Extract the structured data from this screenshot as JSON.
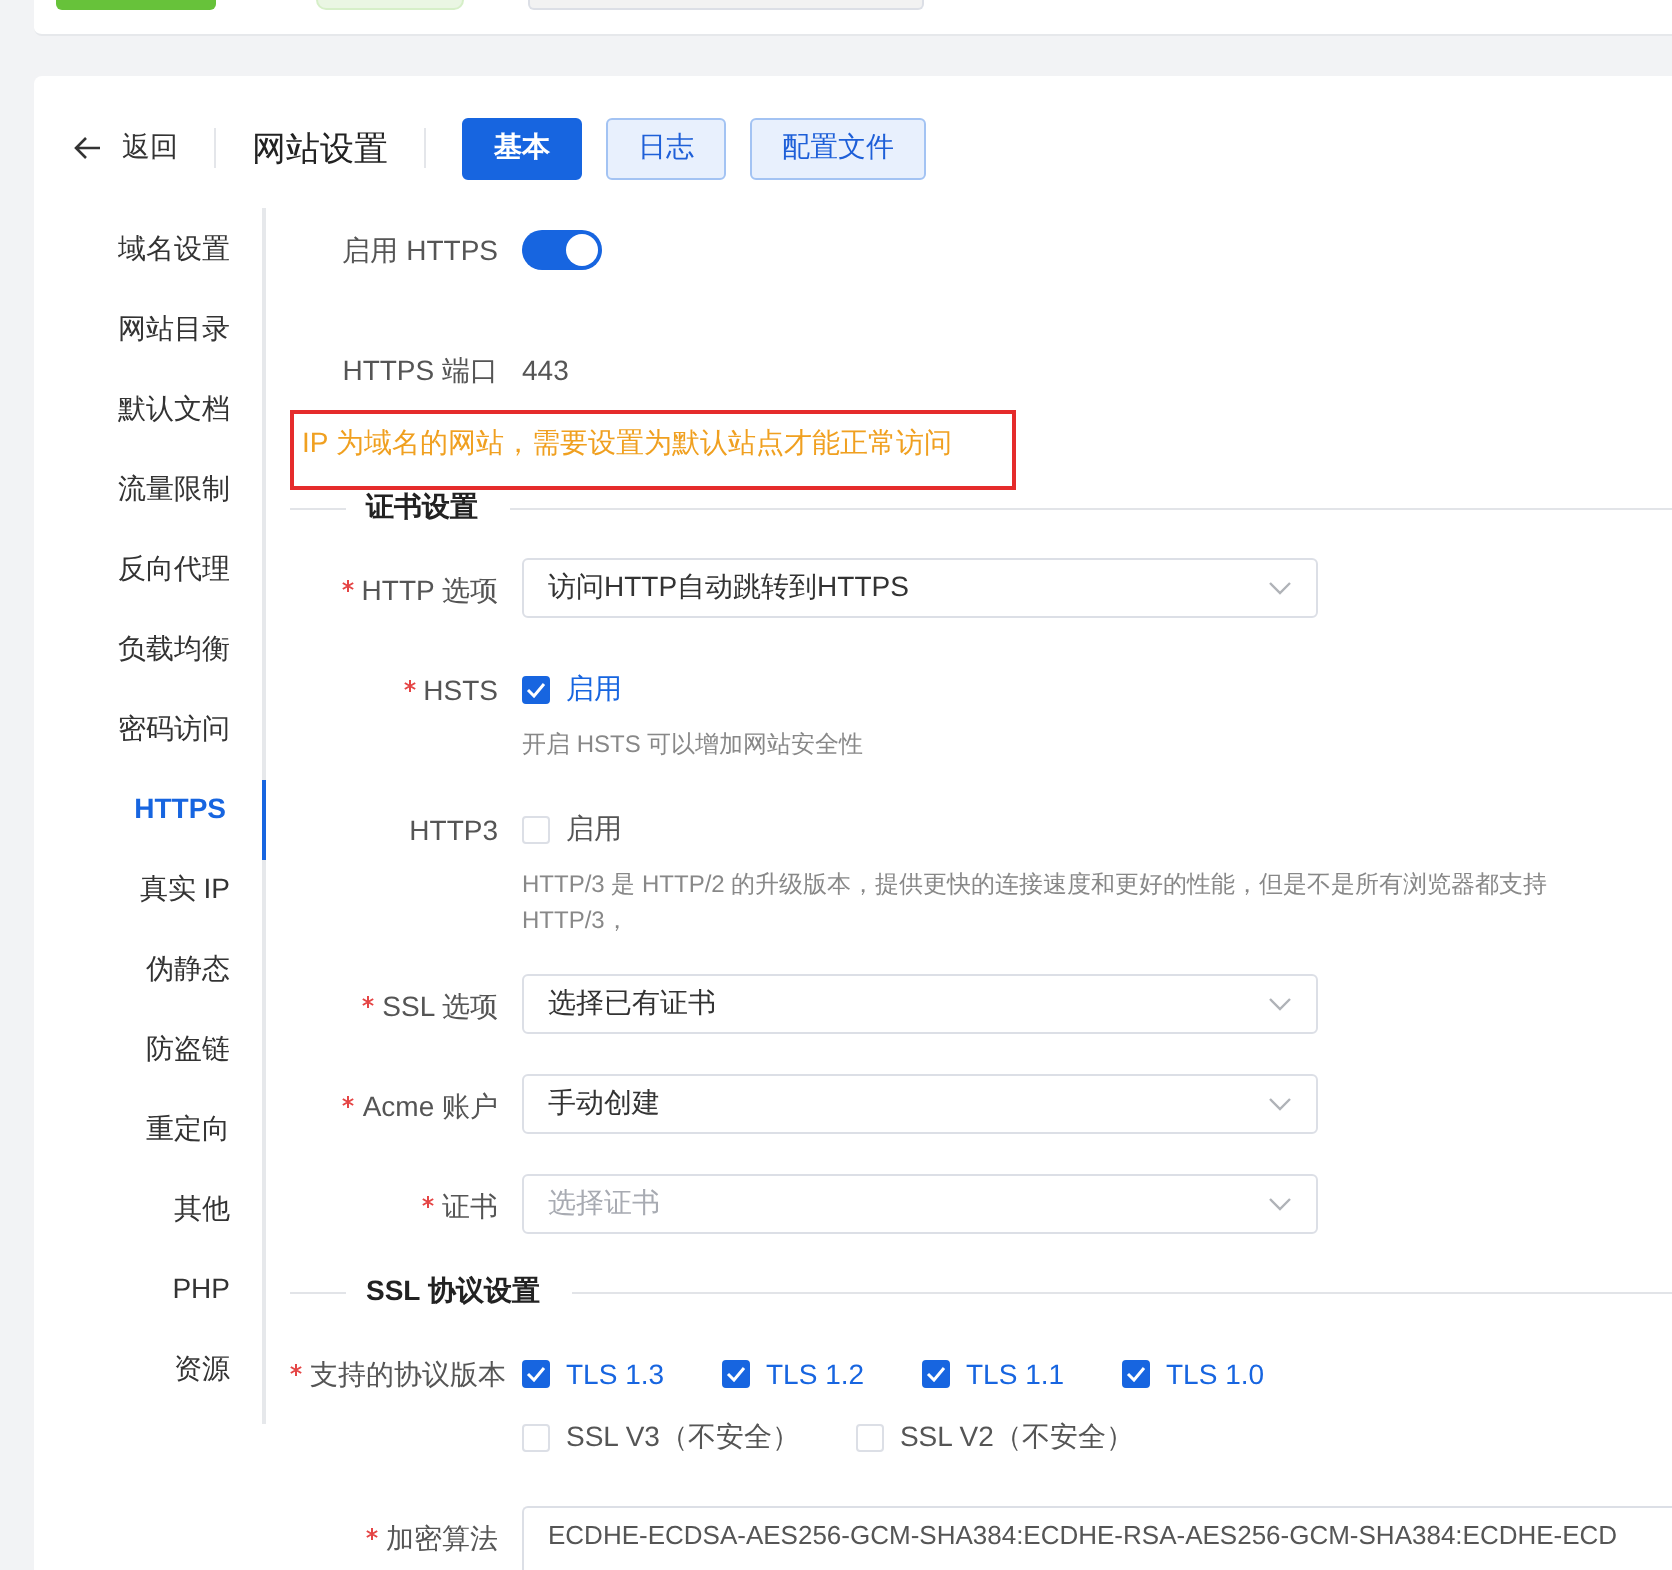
{
  "header": {
    "back": "返回",
    "title": "网站设置",
    "tabs": [
      {
        "label": "基本",
        "selected": true
      },
      {
        "label": "日志",
        "selected": false
      },
      {
        "label": "配置文件",
        "selected": false
      }
    ]
  },
  "sidebar": {
    "items": [
      {
        "label": "域名设置",
        "selected": false
      },
      {
        "label": "网站目录",
        "selected": false
      },
      {
        "label": "默认文档",
        "selected": false
      },
      {
        "label": "流量限制",
        "selected": false
      },
      {
        "label": "反向代理",
        "selected": false
      },
      {
        "label": "负载均衡",
        "selected": false
      },
      {
        "label": "密码访问",
        "selected": false
      },
      {
        "label": "HTTPS",
        "selected": true
      },
      {
        "label": "真实 IP",
        "selected": false
      },
      {
        "label": "伪静态",
        "selected": false
      },
      {
        "label": "防盗链",
        "selected": false
      },
      {
        "label": "重定向",
        "selected": false
      },
      {
        "label": "其他",
        "selected": false
      },
      {
        "label": "PHP",
        "selected": false
      },
      {
        "label": "资源",
        "selected": false
      }
    ]
  },
  "form": [
    {
      "kind": "switch",
      "label": "启用 HTTPS",
      "on": true
    },
    {
      "kind": "text",
      "label": "HTTPS 端口",
      "value": "443"
    },
    {
      "kind": "warning",
      "text": "IP 为域名的网站，需要设置为默认站点才能正常访问"
    },
    {
      "kind": "section",
      "title": "证书设置"
    },
    {
      "kind": "select",
      "label": "HTTP 选项",
      "required": true,
      "value": "访问HTTP自动跳转到HTTPS"
    },
    {
      "kind": "checks",
      "label": "HSTS",
      "required": true,
      "options": [
        [
          {
            "label": "启用",
            "checked": true
          }
        ]
      ],
      "hint": "开启 HSTS 可以增加网站安全性"
    },
    {
      "kind": "checks",
      "label": "HTTP3",
      "required": false,
      "options": [
        [
          {
            "label": "启用",
            "checked": false
          }
        ]
      ],
      "hint": "HTTP/3 是 HTTP/2 的升级版本，提供更快的连接速度和更好的性能，但是不是所有浏览器都支持 HTTP/3，"
    },
    {
      "kind": "select",
      "label": "SSL 选项",
      "required": true,
      "value": "选择已有证书"
    },
    {
      "kind": "select",
      "label": "Acme 账户",
      "required": true,
      "value": "手动创建"
    },
    {
      "kind": "select",
      "label": "证书",
      "required": true,
      "placeholder": "选择证书"
    },
    {
      "kind": "section",
      "title": "SSL 协议设置"
    },
    {
      "kind": "checks",
      "label": "支持的协议版本",
      "required": true,
      "options": [
        [
          {
            "label": "TLS 1.3",
            "checked": true
          },
          {
            "label": "TLS 1.2",
            "checked": true
          },
          {
            "label": "TLS 1.1",
            "checked": true
          },
          {
            "label": "TLS 1.0",
            "checked": true
          }
        ],
        [
          {
            "label": "SSL V3（不安全）",
            "checked": false
          },
          {
            "label": "SSL V2（不安全）",
            "checked": false
          }
        ]
      ]
    },
    {
      "kind": "textarea",
      "label": "加密算法",
      "required": true,
      "value": "ECDHE-ECDSA-AES256-GCM-SHA384:ECDHE-RSA-AES256-GCM-SHA384:ECDHE-ECD"
    }
  ]
}
